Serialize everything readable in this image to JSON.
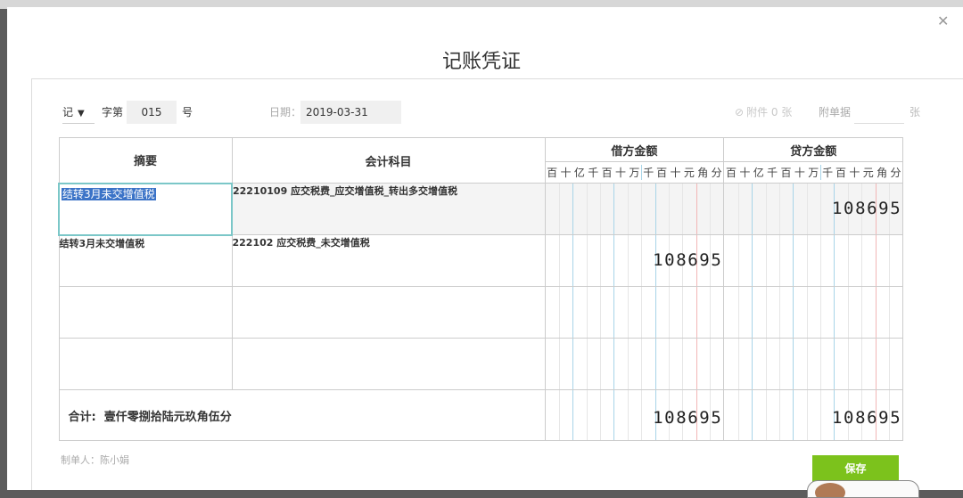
{
  "dialog": {
    "title": "记账凭证",
    "close_icon": "close-icon"
  },
  "header": {
    "voucher_type": "记",
    "ziding_label": "字第",
    "number": "015",
    "hao_label": "号",
    "date_label": "日期：",
    "date": "2019-03-31",
    "attachment_text": "附件 0 张",
    "attachment_icon": "paperclip-icon",
    "fudanju_label": "附单据",
    "fudanju_value": "",
    "zhang_label": "张"
  },
  "table": {
    "col_summary": "摘要",
    "col_account": "会计科目",
    "col_debit": "借方金额",
    "col_credit": "贷方金额",
    "digit_headers": [
      "百",
      "十",
      "亿",
      "千",
      "百",
      "十",
      "万",
      "千",
      "百",
      "十",
      "元",
      "角",
      "分"
    ],
    "rows": [
      {
        "summary": "结转3月未交增值税",
        "account": "22210109 应交税费_应交增值税_转出多交增值税",
        "debit": "",
        "credit": "108695"
      },
      {
        "summary": "结转3月未交增值税",
        "account": "222102 应交税费_未交增值税",
        "debit": "108695",
        "credit": ""
      },
      {
        "summary": "",
        "account": "",
        "debit": "",
        "credit": ""
      },
      {
        "summary": "",
        "account": "",
        "debit": "",
        "credit": ""
      }
    ],
    "total_label": "合计:",
    "total_words": "壹仟零捌拾陆元玖角伍分",
    "total_debit": "108695",
    "total_credit": "108695"
  },
  "footer": {
    "maker": "制单人：陈小娟",
    "save_label": "保存"
  }
}
